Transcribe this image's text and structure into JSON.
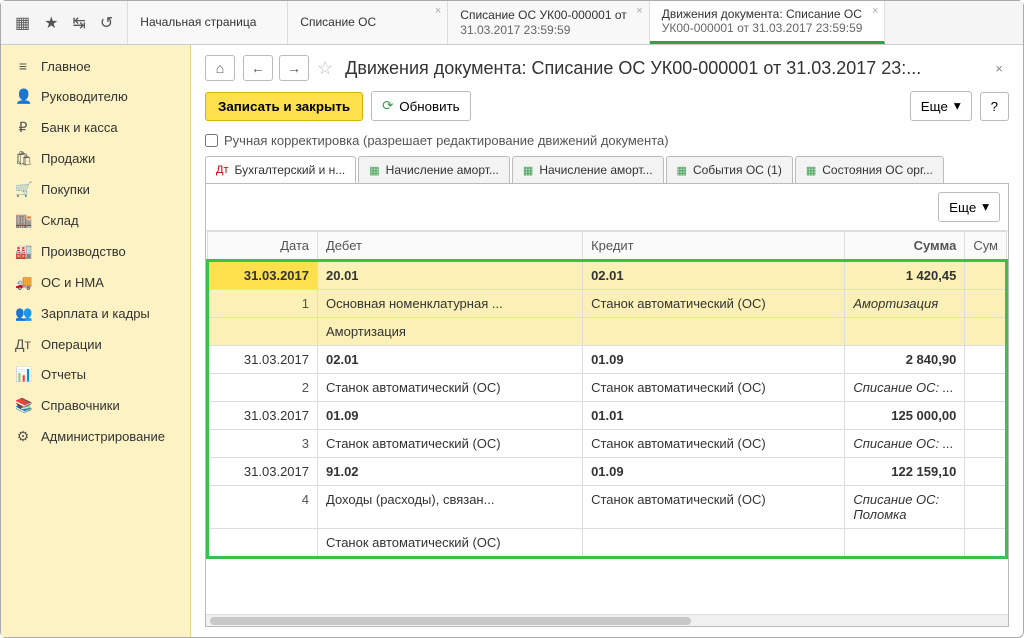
{
  "topIcons": [
    "apps",
    "star",
    "arrows",
    "clock"
  ],
  "tabs": [
    {
      "line1": "Начальная страница",
      "line2": ""
    },
    {
      "line1": "Списание ОС",
      "line2": ""
    },
    {
      "line1": "Списание ОС УК00-000001 от",
      "line2": "31.03.2017 23:59:59"
    },
    {
      "line1": "Движения документа: Списание ОС",
      "line2": "УК00-000001 от 31.03.2017 23:59:59",
      "active": true
    }
  ],
  "sidebar": [
    {
      "ico": "≡",
      "label": "Главное"
    },
    {
      "ico": "👤",
      "label": "Руководителю"
    },
    {
      "ico": "₽",
      "label": "Банк и касса"
    },
    {
      "ico": "🛍",
      "label": "Продажи"
    },
    {
      "ico": "🛒",
      "label": "Покупки"
    },
    {
      "ico": "🏬",
      "label": "Склад"
    },
    {
      "ico": "🏭",
      "label": "Производство"
    },
    {
      "ico": "🚚",
      "label": "ОС и НМА"
    },
    {
      "ico": "👥",
      "label": "Зарплата и кадры"
    },
    {
      "ico": "Дт",
      "label": "Операции"
    },
    {
      "ico": "📊",
      "label": "Отчеты"
    },
    {
      "ico": "📚",
      "label": "Справочники"
    },
    {
      "ico": "⚙",
      "label": "Администрирование"
    }
  ],
  "title": "Движения документа: Списание ОС УК00-000001 от 31.03.2017 23:...",
  "toolbar": {
    "save": "Записать и закрыть",
    "refresh": "Обновить",
    "more": "Еще",
    "help": "?"
  },
  "checkbox_label": "Ручная корректировка (разрешает редактирование движений документа)",
  "inner_tabs": [
    "Бухгалтерский и н...",
    "Начисление аморт...",
    "Начисление аморт...",
    "События ОС (1)",
    "Состояния ОС орг..."
  ],
  "table_toolbar_more": "Еще",
  "columns": {
    "date": "Дата",
    "debit": "Дебет",
    "credit": "Кредит",
    "sum": "Сумма",
    "extra": "Сум"
  },
  "rows": [
    {
      "date": "31.03.2017",
      "n": "1",
      "debit_acc": "20.01",
      "debit_l2": "Основная номенклатурная ...",
      "debit_l3": "Амортизация",
      "credit_acc": "02.01",
      "credit_l2": "Станок автоматический (ОС)",
      "sum": "1 420,45",
      "comment": "Амортизация",
      "highlight": true
    },
    {
      "date": "31.03.2017",
      "n": "2",
      "debit_acc": "02.01",
      "debit_l2": "Станок автоматический (ОС)",
      "credit_acc": "01.09",
      "credit_l2": "Станок автоматический (ОС)",
      "sum": "2 840,90",
      "comment": "Списание ОС: ..."
    },
    {
      "date": "31.03.2017",
      "n": "3",
      "debit_acc": "01.09",
      "debit_l2": "Станок автоматический (ОС)",
      "credit_acc": "01.01",
      "credit_l2": "Станок автоматический (ОС)",
      "sum": "125 000,00",
      "comment": "Списание ОС: ..."
    },
    {
      "date": "31.03.2017",
      "n": "4",
      "debit_acc": "91.02",
      "debit_l2": "Доходы (расходы), связан...",
      "debit_l3": "Станок автоматический (ОС)",
      "credit_acc": "01.09",
      "credit_l2": "Станок автоматический (ОС)",
      "sum": "122 159,10",
      "comment": "Списание ОС: Поломка"
    }
  ]
}
